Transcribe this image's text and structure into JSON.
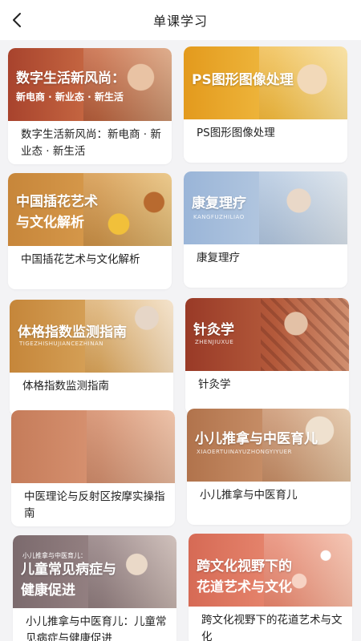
{
  "header": {
    "title": "单课学习",
    "back_icon": "chevron-left-icon"
  },
  "courses": [
    {
      "thumb_line1": "数字生活新风尚：",
      "thumb_line2": "新电商 · 新业态 · 新生活",
      "thumb_pinyin": "",
      "thumb_pre": "",
      "title": "数字生活新风尚：新电商 · 新业态 · 新生活",
      "colors": [
        "#a8432d",
        "#d58a4e"
      ]
    },
    {
      "thumb_line1": "PS图形图像处理",
      "thumb_line2": "",
      "thumb_pinyin": "",
      "thumb_pre": "",
      "title": "PS图形图像处理",
      "colors": [
        "#e09a1f",
        "#f4cf63"
      ]
    },
    {
      "thumb_line1": "中国插花艺术",
      "thumb_line2": "与文化解析",
      "thumb_pinyin": "",
      "thumb_pre": "",
      "title": "中国插花艺术与文化解析",
      "colors": [
        "#c98a3a",
        "#e7b05a"
      ]
    },
    {
      "thumb_line1": "康复理疗",
      "thumb_line2": "",
      "thumb_pinyin": "KANGFUZHILIAO",
      "thumb_pre": "",
      "title": "康复理疗",
      "colors": [
        "#9db7d8",
        "#c9d7e6"
      ]
    },
    {
      "thumb_line1": "体格指数监测指南",
      "thumb_line2": "",
      "thumb_pinyin": "TIGEZHISHUJIANCEZHINAN",
      "thumb_pre": "",
      "title": "体格指数监测指南",
      "colors": [
        "#c68a3a",
        "#e9c07e"
      ]
    },
    {
      "thumb_line1": "针灸学",
      "thumb_line2": "",
      "thumb_pinyin": "ZHENJIUXUE",
      "thumb_pre": "",
      "title": "针灸学",
      "colors": [
        "#9a3a28",
        "#c87a55"
      ]
    },
    {
      "thumb_line1": "",
      "thumb_line2": "",
      "thumb_pinyin": "",
      "thumb_pre": "",
      "title": "中医理论与反射区按摩实操指南",
      "colors": [
        "#c88060",
        "#e6b194"
      ]
    },
    {
      "thumb_line1": "小儿推拿与中医育儿",
      "thumb_line2": "",
      "thumb_pinyin": "XIAOERTUINAYUZHONGYIYUER",
      "thumb_pre": "",
      "title": "小儿推拿与中医育儿",
      "colors": [
        "#b5764d",
        "#dcb38b"
      ]
    },
    {
      "thumb_line1": "儿童常见病症与",
      "thumb_line2": "健康促进",
      "thumb_pinyin": "",
      "thumb_pre": "小儿推拿与中医育儿：",
      "title": "小儿推拿与中医育儿：儿童常见病症与健康促进",
      "colors": [
        "#7a6a6e",
        "#b7a3a0"
      ]
    },
    {
      "thumb_line1": "跨文化视野下的",
      "thumb_line2": "花道艺术与文化",
      "thumb_pinyin": "",
      "thumb_pre": "",
      "title": "跨文化视野下的花道艺术与文化",
      "colors": [
        "#d86a55",
        "#f0a58a"
      ]
    }
  ]
}
